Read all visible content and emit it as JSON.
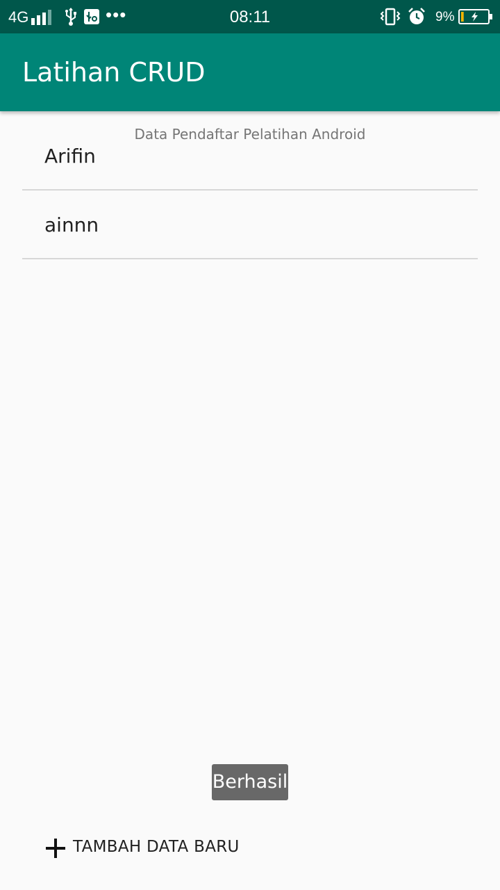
{
  "status_bar": {
    "network": "4G",
    "time": "08:11",
    "battery_percent": "9%",
    "battery_level": 0.09,
    "icons": [
      "signal-icon",
      "usb-icon",
      "usb-debugging-icon",
      "more-notifications-icon",
      "vibrate-icon",
      "alarm-icon",
      "battery-charging-icon"
    ],
    "more_dots": "•••"
  },
  "app_bar": {
    "title": "Latihan CRUD"
  },
  "list": {
    "header": "Data Pendaftar Pelatihan Android",
    "items": [
      {
        "label": "Arifin"
      },
      {
        "label": "ainnn"
      }
    ]
  },
  "toast": {
    "message": "Berhasil"
  },
  "add_button": {
    "label": "TAMBAH DATA BARU",
    "icon": "plus-icon"
  },
  "colors": {
    "status_bar": "#00574b",
    "app_bar": "#008577",
    "background": "#fafafa",
    "divider": "#d7d7d7",
    "toast": "#686868",
    "battery_fill": "#f5b400"
  }
}
